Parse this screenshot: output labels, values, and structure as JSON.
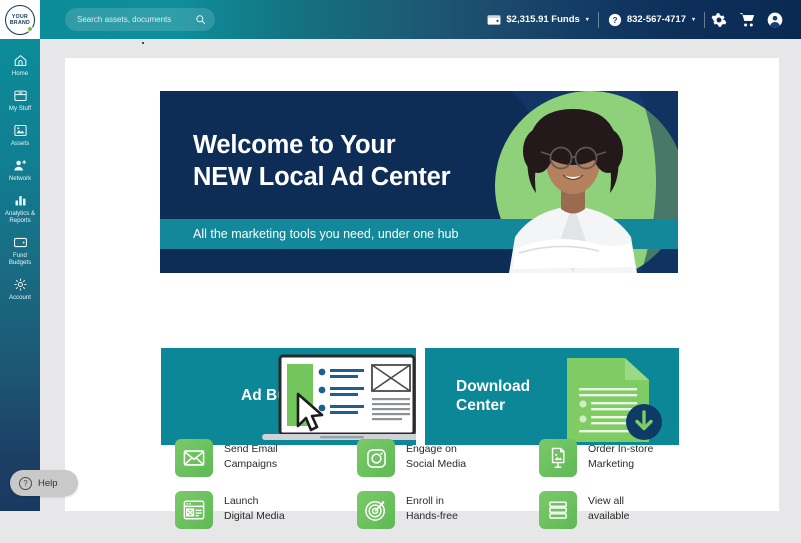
{
  "brand": {
    "logo_line1": "YOUR",
    "logo_line2": "BRAND",
    "accent_green": "#7ac143",
    "accent_teal": "#0b8797",
    "accent_navy": "#0d2d57"
  },
  "topbar": {
    "search": {
      "placeholder": "Search assets, documents",
      "value": "",
      "icon": "search-icon"
    },
    "funds": {
      "label": "$2,315.91 Funds",
      "icon": "wallet-icon",
      "caret": "▾"
    },
    "phone": {
      "label": "832-567-4717",
      "icon": "help-chat-icon",
      "caret": "▾"
    },
    "settings_icon": "gear-icon",
    "cart_icon": "cart-icon",
    "account_icon": "user-avatar-icon"
  },
  "sidebar": {
    "items": [
      {
        "label": "Home",
        "icon": "home-icon"
      },
      {
        "label": "My Stuff",
        "icon": "folder-icon"
      },
      {
        "label": "Assets",
        "icon": "image-asset-icon"
      },
      {
        "label": "Network",
        "icon": "people-add-icon"
      },
      {
        "label": "Analytics\n& Reports",
        "icon": "bar-chart-icon"
      },
      {
        "label": "Fund\nBudgets",
        "icon": "wallet-icon"
      },
      {
        "label": "Account",
        "icon": "gear-icon"
      }
    ]
  },
  "help": {
    "label": "Help",
    "icon": "question-mark-icon"
  },
  "hero": {
    "heading": "Welcome to Your\nNEW Local Ad Center",
    "subheading": "All the marketing tools you need, under one hub",
    "photo_alt": "smiling-woman-portrait"
  },
  "cards": [
    {
      "title": "Ad Building",
      "icon": "laptop-ad-builder-icon"
    },
    {
      "title": "Download\nCenter",
      "icon": "download-document-icon"
    }
  ],
  "quick_links": [
    {
      "label": "Send Email\nCampaigns",
      "icon": "envelope-icon"
    },
    {
      "label": "Engage on\nSocial Media",
      "icon": "camera-social-icon"
    },
    {
      "label": "Order In-store\nMarketing",
      "icon": "in-store-signage-icon"
    },
    {
      "label": "Launch\nDigital Media",
      "icon": "digital-media-banner-icon"
    },
    {
      "label": "Enroll in\nHands-free",
      "icon": "target-dart-icon"
    },
    {
      "label": "View all\navailable",
      "icon": "stacked-layers-icon"
    }
  ]
}
